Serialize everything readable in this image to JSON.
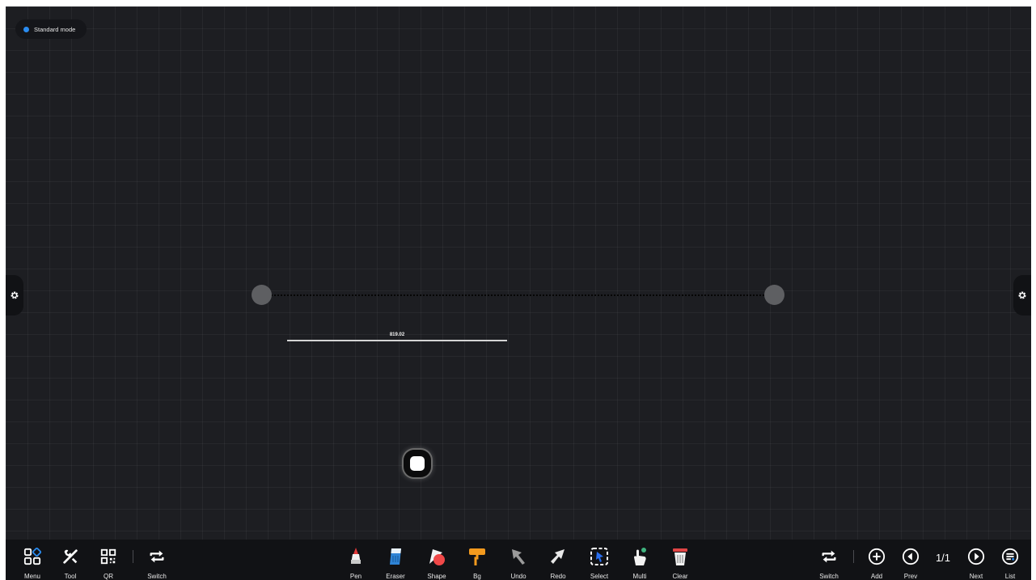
{
  "mode_badge": {
    "label": "Standard mode",
    "dot_color": "#2a8cf0"
  },
  "side_panels": {
    "left_icon": "gear-icon",
    "right_icon": "gear-icon"
  },
  "measurement": {
    "value": "819.02"
  },
  "floating_button": {
    "icon": "rounded-square-icon"
  },
  "toolbar": {
    "left": [
      {
        "id": "menu",
        "label": "Menu",
        "icon": "menu-grid-icon"
      },
      {
        "id": "tool",
        "label": "Tool",
        "icon": "tools-icon"
      },
      {
        "id": "qr",
        "label": "QR",
        "icon": "qr-code-icon"
      },
      {
        "id": "switch",
        "label": "Switch",
        "icon": "switch-arrows-icon"
      }
    ],
    "center": [
      {
        "id": "pen",
        "label": "Pen",
        "icon": "pen-icon"
      },
      {
        "id": "eraser",
        "label": "Eraser",
        "icon": "eraser-icon"
      },
      {
        "id": "shape",
        "label": "Shape",
        "icon": "shape-icon"
      },
      {
        "id": "bg",
        "label": "Bg",
        "icon": "paint-roller-icon"
      },
      {
        "id": "undo",
        "label": "Undo",
        "icon": "undo-arrow-icon"
      },
      {
        "id": "redo",
        "label": "Redo",
        "icon": "redo-arrow-icon"
      },
      {
        "id": "select",
        "label": "Select",
        "icon": "select-icon"
      },
      {
        "id": "multi",
        "label": "Multi",
        "icon": "multi-touch-icon"
      },
      {
        "id": "clear",
        "label": "Clear",
        "icon": "trash-icon"
      }
    ],
    "right": [
      {
        "id": "switch2",
        "label": "Switch",
        "icon": "switch-arrows-icon"
      },
      {
        "id": "add",
        "label": "Add",
        "icon": "add-circle-icon"
      },
      {
        "id": "prev",
        "label": "Prev",
        "icon": "prev-circle-icon"
      },
      {
        "id": "next",
        "label": "Next",
        "icon": "next-circle-icon"
      },
      {
        "id": "list",
        "label": "List",
        "icon": "list-circle-icon"
      }
    ],
    "page_indicator": "1/1"
  }
}
